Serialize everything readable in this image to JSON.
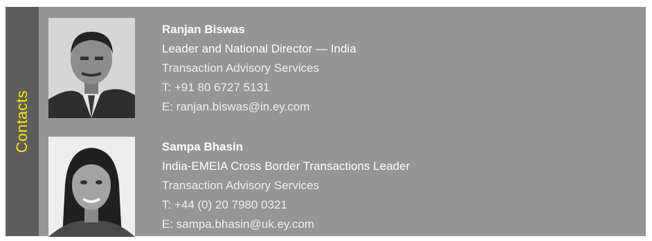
{
  "section_label": "Contacts",
  "contacts": [
    {
      "name": "Ranjan Biswas",
      "title": "Leader and National Director — India",
      "department": "Transaction Advisory Services",
      "phone": "T: +91 80 6727 5131",
      "email": "E: ranjan.biswas@in.ey.com"
    },
    {
      "name": "Sampa Bhasin",
      "title": "India-EMEIA Cross Border Transactions Leader",
      "department": "Transaction Advisory Services",
      "phone": "T: +44 (0) 20 7980 0321",
      "email": "E: sampa.bhasin@uk.ey.com"
    }
  ],
  "colors": {
    "panel": "#959595",
    "side_tab": "#5d5d5d",
    "accent": "#ffe600",
    "text": "#ffffff"
  }
}
